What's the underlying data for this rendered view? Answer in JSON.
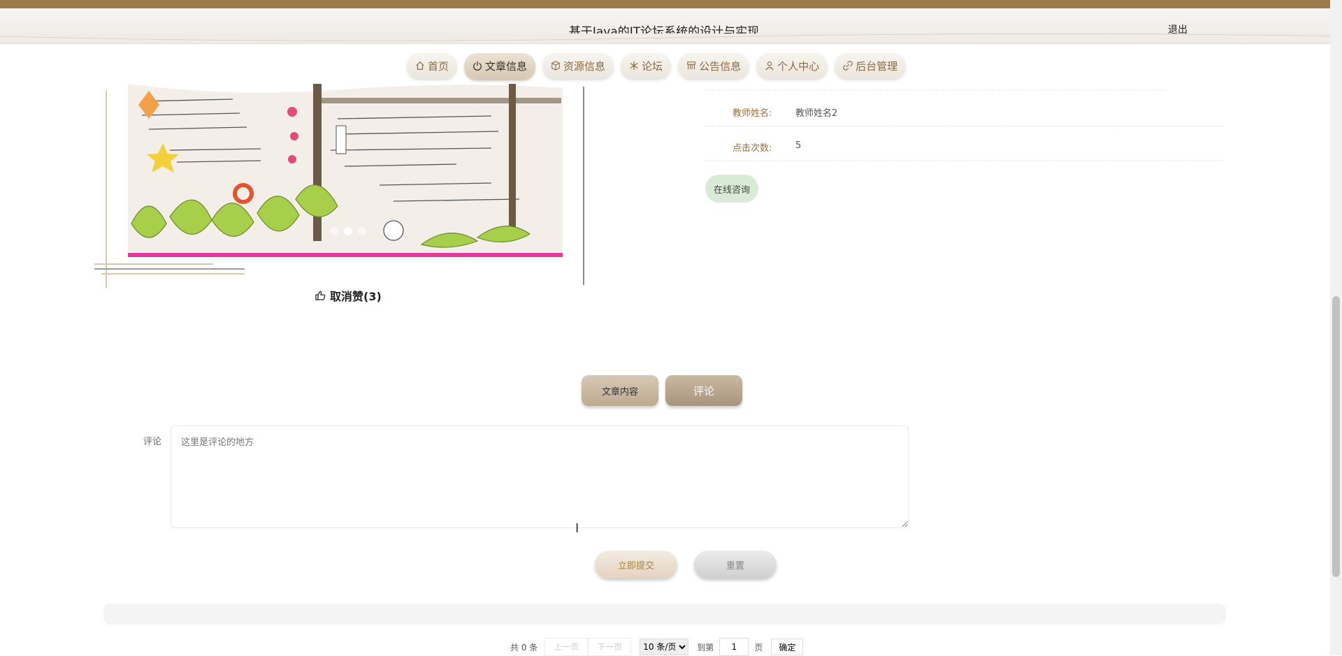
{
  "header": {
    "title": "基于Java的IT论坛系统的设计与实现",
    "logout": "退出"
  },
  "nav": [
    {
      "label": "首页",
      "icon": "home-icon"
    },
    {
      "label": "文章信息",
      "icon": "power-icon",
      "active": true
    },
    {
      "label": "资源信息",
      "icon": "box-icon"
    },
    {
      "label": "论坛",
      "icon": "snowflake-icon"
    },
    {
      "label": "公告信息",
      "icon": "grid-icon"
    },
    {
      "label": "个人中心",
      "icon": "user-icon"
    },
    {
      "label": "后台管理",
      "icon": "link-icon"
    }
  ],
  "gallery": {
    "slides": 3,
    "active_slide": 2
  },
  "like": {
    "label": "取消赞(3)",
    "icon": "thumbs-up-icon"
  },
  "info": [
    {
      "label": "教师姓名:",
      "value": "教师姓名2"
    },
    {
      "label": "点击次数:",
      "value": "5"
    }
  ],
  "consult_label": "在线咨询",
  "tabs": {
    "content": "文章内容",
    "comment": "评论"
  },
  "comment": {
    "label": "评论",
    "placeholder": "这里是评论的地方"
  },
  "buttons": {
    "submit": "立即提交",
    "reset": "重置"
  },
  "pager": {
    "total": "共 0 条",
    "prev": "上一页",
    "next": "下一页",
    "page_size": "10 条/页",
    "goto_prefix": "到第",
    "page": "1",
    "goto_suffix": "页",
    "confirm": "确定"
  },
  "colors": {
    "accent": "#9c7a4a",
    "nav_text": "#8a6a3e",
    "label_brown": "#9c6e3c",
    "consult_bg": "#d8ebd5"
  }
}
